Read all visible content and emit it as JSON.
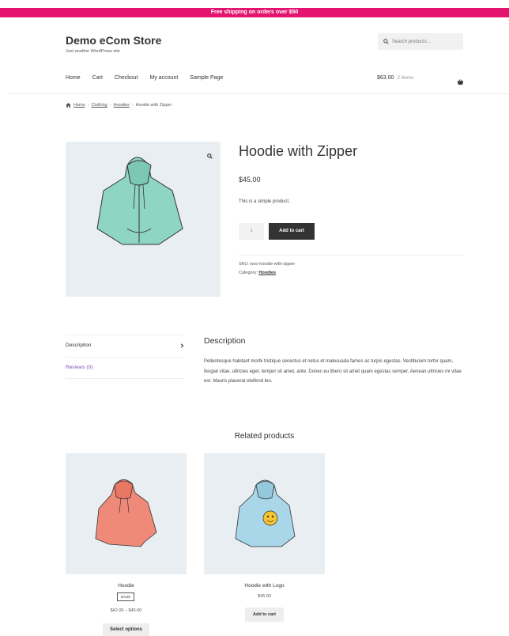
{
  "banner": {
    "text": "Free shipping on orders over $50"
  },
  "site": {
    "title": "Demo eCom Store",
    "tagline": "Just another WordPress site"
  },
  "search": {
    "placeholder": "Search products…"
  },
  "nav": {
    "items": [
      "Home",
      "Cart",
      "Checkout",
      "My account",
      "Sample Page"
    ]
  },
  "cart": {
    "total": "$63.00",
    "items": "2 items"
  },
  "breadcrumb": {
    "home": "Home",
    "clothing": "Clothing",
    "hoodies": "Hoodies",
    "current": "Hoodie with Zipper",
    "sep": "›"
  },
  "product": {
    "title": "Hoodie with Zipper",
    "price": "$45.00",
    "short_description": "This is a simple product.",
    "quantity": "1",
    "add_to_cart": "Add to cart",
    "sku_label": "SKU:",
    "sku": "woo-hoodie-with-zipper",
    "category_label": "Category:",
    "category": "Hoodies"
  },
  "tabs": {
    "description": "Description",
    "reviews": "Reviews (0)"
  },
  "description": {
    "title": "Description",
    "text": "Pellentesque habitant morbi tristique senectus et netus et malesuada fames ac turpis egestas. Vestibulum tortor quam, feugiat vitae, ultricies eget, tempor sit amet, ante. Donec eu libero sit amet quam egestas semper. Aenean ultricies mi vitae est. Mauris placerat eleifend leo."
  },
  "related": {
    "title": "Related products",
    "products": [
      {
        "name": "Hoodie",
        "badge": "SALE!",
        "price": "$42.00 – $45.00",
        "button": "Select options"
      },
      {
        "name": "Hoodie with Logo",
        "price": "$45.00",
        "button": "Add to cart"
      }
    ]
  },
  "colors": {
    "banner": "#e3136f",
    "reviews_link": "#7f54b3",
    "hoodie_zipper": "#8fd5c4",
    "hoodie_orange": "#f08a78",
    "hoodie_logo": "#a9d6e8"
  },
  "icons": [
    "search-icon",
    "basket-icon",
    "home-icon",
    "zoom-icon",
    "chevron-right-icon"
  ]
}
